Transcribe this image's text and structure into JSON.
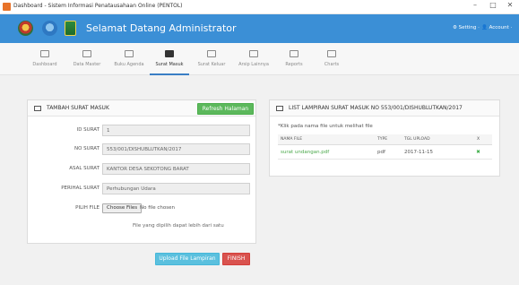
{
  "window": {
    "title": "Dashboard - Sistem Informasi Penatausahaan Online (PENTOL)",
    "minimize": "–",
    "maximize": "□",
    "close": "✕"
  },
  "header": {
    "brand": "Selamat Datang Administrator",
    "setting_label": "⚙ Setting ·",
    "account_label": "👤 Account ·"
  },
  "nav": {
    "items": [
      {
        "label": "Dashboard",
        "icon": "home-icon"
      },
      {
        "label": "Data Master",
        "icon": "table-icon"
      },
      {
        "label": "Buku Agenda",
        "icon": "book-icon"
      },
      {
        "label": "Surat Masuk",
        "icon": "envelope-icon",
        "active": true
      },
      {
        "label": "Surat Keluar",
        "icon": "send-icon"
      },
      {
        "label": "Arsip Lainnya",
        "icon": "archive-icon"
      },
      {
        "label": "Reports",
        "icon": "copy-icon"
      },
      {
        "label": "Charts",
        "icon": "chart-icon"
      }
    ]
  },
  "form_panel": {
    "title": "TAMBAH SURAT MASUK",
    "refresh_button": "Refresh Halaman",
    "fields": [
      {
        "label": "ID SURAT",
        "value": "1"
      },
      {
        "label": "NO SURAT",
        "value": "553/001/DISHUBLUTKAN/2017"
      },
      {
        "label": "ASAL SURAT",
        "value": "KANTOR DESA SEKOTONG BARAT"
      },
      {
        "label": "PERIHAL SURAT",
        "value": "Perhubungan Udara"
      }
    ],
    "file_label": "PILIH FILE",
    "file_button": "Choose Files",
    "file_status": "No file chosen",
    "hint": "File yang dipilih dapat lebih dari satu",
    "upload_button": "Upload File Lampiran",
    "finish_button": "FINISH"
  },
  "list_panel": {
    "title": "LIST LAMPIRAN SURAT MASUK NO 553/001/DISHUBLUTKAN/2017",
    "note": "*Klik pada nama file untuk melihat file",
    "columns": [
      "NAMA FILE",
      "TYPE",
      "TGL UPLOAD",
      "X"
    ],
    "rows": [
      {
        "name": "surat undangan.pdf",
        "type": "pdf",
        "date": "2017-11-15",
        "delete": "✖"
      }
    ]
  }
}
